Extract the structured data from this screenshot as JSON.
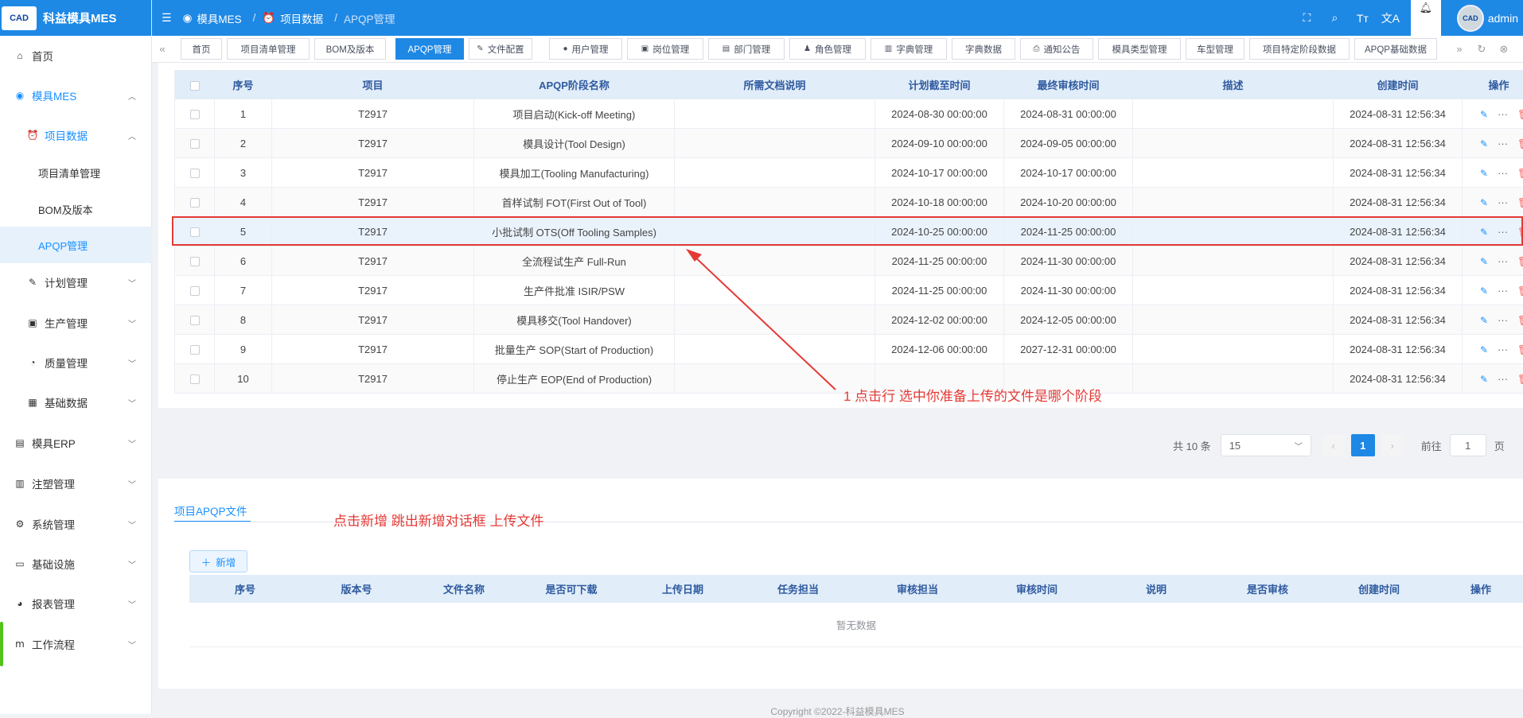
{
  "app": {
    "logo_text": "CAD",
    "title": "科益模具MES"
  },
  "sidebar": {
    "items": [
      {
        "label": "首页"
      },
      {
        "label": "模具MES"
      },
      {
        "label": "项目数据"
      },
      {
        "label": "项目清单管理"
      },
      {
        "label": "BOM及版本"
      },
      {
        "label": "APQP管理"
      },
      {
        "label": "计划管理"
      },
      {
        "label": "生产管理"
      },
      {
        "label": "质量管理"
      },
      {
        "label": "基础数据"
      },
      {
        "label": "模具ERP"
      },
      {
        "label": "注塑管理"
      },
      {
        "label": "系统管理"
      },
      {
        "label": "基础设施"
      },
      {
        "label": "报表管理"
      },
      {
        "label": "工作流程"
      }
    ]
  },
  "breadcrumb": [
    "模具MES",
    "项目数据",
    "APQP管理"
  ],
  "user": {
    "name": "admin",
    "avatar_text": "CAD"
  },
  "tabs": [
    "首页",
    "项目清单管理",
    "BOM及版本",
    "APQP管理",
    "文件配置",
    "用户管理",
    "岗位管理",
    "部门管理",
    "角色管理",
    "字典管理",
    "字典数据",
    "通知公告",
    "模具类型管理",
    "车型管理",
    "项目特定阶段数据",
    "APQP基础数据"
  ],
  "main_table": {
    "headers": [
      "序号",
      "项目",
      "APQP阶段名称",
      "所需文档说明",
      "计划截至时间",
      "最终审核时间",
      "描述",
      "创建时间",
      "操作"
    ],
    "rows": [
      [
        "1",
        "T2917",
        "项目启动(Kick-off Meeting)",
        "",
        "2024-08-30 00:00:00",
        "2024-08-31 00:00:00",
        "",
        "2024-08-31 12:56:34"
      ],
      [
        "2",
        "T2917",
        "模具设计(Tool Design)",
        "",
        "2024-09-10 00:00:00",
        "2024-09-05 00:00:00",
        "",
        "2024-08-31 12:56:34"
      ],
      [
        "3",
        "T2917",
        "模具加工(Tooling Manufacturing)",
        "",
        "2024-10-17 00:00:00",
        "2024-10-17 00:00:00",
        "",
        "2024-08-31 12:56:34"
      ],
      [
        "4",
        "T2917",
        "首样试制 FOT(First Out of Tool)",
        "",
        "2024-10-18 00:00:00",
        "2024-10-20 00:00:00",
        "",
        "2024-08-31 12:56:34"
      ],
      [
        "5",
        "T2917",
        "小批试制 OTS(Off Tooling Samples)",
        "",
        "2024-10-25 00:00:00",
        "2024-11-25 00:00:00",
        "",
        "2024-08-31 12:56:34"
      ],
      [
        "6",
        "T2917",
        "全流程试生产 Full-Run",
        "",
        "2024-11-25 00:00:00",
        "2024-11-30 00:00:00",
        "",
        "2024-08-31 12:56:34"
      ],
      [
        "7",
        "T2917",
        "生产件批准 ISIR/PSW",
        "",
        "2024-11-25 00:00:00",
        "2024-11-30 00:00:00",
        "",
        "2024-08-31 12:56:34"
      ],
      [
        "8",
        "T2917",
        "模具移交(Tool Handover)",
        "",
        "2024-12-02 00:00:00",
        "2024-12-05 00:00:00",
        "",
        "2024-08-31 12:56:34"
      ],
      [
        "9",
        "T2917",
        "批量生产 SOP(Start of Production)",
        "",
        "2024-12-06 00:00:00",
        "2027-12-31 00:00:00",
        "",
        "2024-08-31 12:56:34"
      ],
      [
        "10",
        "T2917",
        "停止生产 EOP(End of Production)",
        "",
        "",
        "",
        "",
        "2024-08-31 12:56:34"
      ]
    ],
    "selected_row": 5
  },
  "pagination": {
    "total": "共 10 条",
    "page_size": "15",
    "current": "1",
    "goto_label": "前往",
    "goto_value": "1",
    "page_unit": "页"
  },
  "annotations": {
    "row_hint": "1 点击行 选中你准备上传的文件是哪个阶段",
    "add_hint": "点击新增 跳出新增对话框 上传文件"
  },
  "file_section": {
    "tab": "项目APQP文件",
    "add_label": "新增",
    "headers": [
      "序号",
      "版本号",
      "文件名称",
      "是否可下载",
      "上传日期",
      "任务担当",
      "审核担当",
      "审核时间",
      "说明",
      "是否审核",
      "创建时间",
      "操作"
    ],
    "empty": "暂无数据"
  },
  "footer": "Copyright ©2022-科益模具MES",
  "colors": {
    "primary": "#1e88e5",
    "annotation": "#e53935",
    "header_bg": "#e1edf8"
  }
}
